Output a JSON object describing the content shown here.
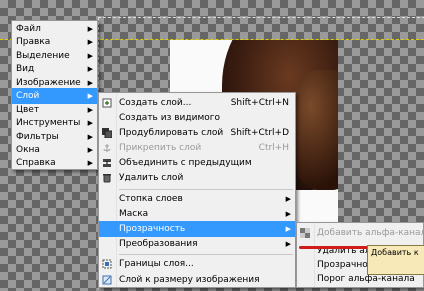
{
  "menubar_menu": {
    "items": [
      {
        "label": "Файл",
        "arrow": "▶"
      },
      {
        "label": "Правка",
        "arrow": "▶"
      },
      {
        "label": "Выделение",
        "arrow": "▶"
      },
      {
        "label": "Вид",
        "arrow": "▶"
      },
      {
        "label": "Изображение",
        "arrow": "▶"
      },
      {
        "label": "Слой",
        "arrow": "▶"
      },
      {
        "label": "Цвет",
        "arrow": "▶"
      },
      {
        "label": "Инструменты",
        "arrow": "▶"
      },
      {
        "label": "Фильтры",
        "arrow": "▶"
      },
      {
        "label": "Окна",
        "arrow": "▶"
      },
      {
        "label": "Справка",
        "arrow": "▶"
      }
    ]
  },
  "layer_menu": {
    "items": [
      {
        "label": "Создать слой...",
        "shortcut": "Shift+Ctrl+N",
        "icon": "new-layer-icon"
      },
      {
        "label": "Создать из видимого",
        "shortcut": ""
      },
      {
        "label": "Продублировать слой",
        "shortcut": "Shift+Ctrl+D",
        "icon": "duplicate-layer-icon"
      },
      {
        "label": "Прикрепить слой",
        "shortcut": "Ctrl+H",
        "icon": "anchor-icon"
      },
      {
        "label": "Объединить с предыдущим",
        "shortcut": "",
        "icon": "merge-down-icon"
      },
      {
        "label": "Удалить слой",
        "shortcut": "",
        "icon": "delete-layer-icon"
      },
      {
        "label": "Стопка слоев",
        "arrow": "▶"
      },
      {
        "label": "Маска",
        "arrow": "▶"
      },
      {
        "label": "Прозрачность",
        "arrow": "▶"
      },
      {
        "label": "Преобразования",
        "arrow": "▶"
      },
      {
        "label": "Границы слоя...",
        "icon": "layer-boundary-icon"
      },
      {
        "label": "Слой к размеру изображения",
        "icon": "layer-to-image-size-icon"
      }
    ]
  },
  "transparency_menu": {
    "items": [
      {
        "label": "Добавить альфа-канал",
        "icon": "alpha-channel-icon"
      },
      {
        "label": "Удалить альфа"
      },
      {
        "label": "Прозрачность"
      },
      {
        "label": "Порог альфа-канала"
      }
    ]
  },
  "tooltip": {
    "text": "Добавить к"
  },
  "colors": {
    "highlight": "#3399ff",
    "menu_bg": "#f0f0f0",
    "annotation": "#d11a1a"
  }
}
